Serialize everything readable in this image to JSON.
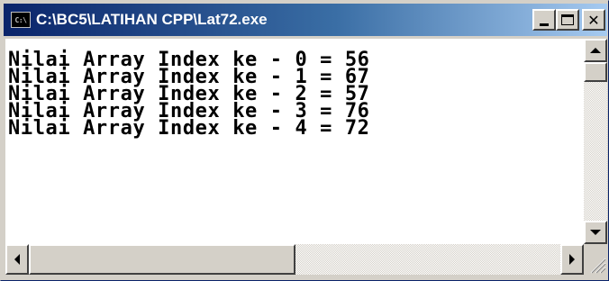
{
  "window": {
    "title": "C:\\BC5\\LATIHAN CPP\\Lat72.exe",
    "icon": "console-icon",
    "icon_text": "C:\\",
    "colors": {
      "titlebar_start": "#0a246a",
      "titlebar_end": "#a6caf0",
      "console_bg": "#ffffff",
      "console_text": "#000000"
    }
  },
  "caption_buttons": {
    "minimize": "minimize-icon",
    "maximize": "maximize-icon",
    "close": "close-icon",
    "close_label": "✕"
  },
  "console": {
    "lines": [
      "Nilai Array Index ke - 0 = 56",
      "Nilai Array Index ke - 1 = 67",
      "Nilai Array Index ke - 2 = 57",
      "Nilai Array Index ke - 3 = 76",
      "Nilai Array Index ke - 4 = 72"
    ]
  },
  "scrollbars": {
    "up": "arrow-up-icon",
    "down": "arrow-down-icon",
    "left": "arrow-left-icon",
    "right": "arrow-right-icon",
    "grip": "resize-grip-icon"
  }
}
